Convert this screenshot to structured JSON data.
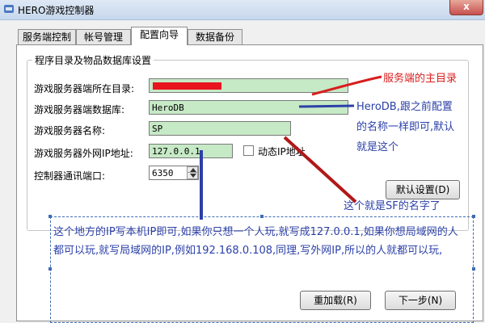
{
  "window": {
    "title": "HERO游戏控制器",
    "close_label": "x"
  },
  "tabs": [
    {
      "label": "服务端控制",
      "active": false
    },
    {
      "label": "帐号管理",
      "active": false
    },
    {
      "label": "配置向导",
      "active": true
    },
    {
      "label": "数据备份",
      "active": false
    }
  ],
  "group": {
    "title": "程序目录及物品数据库设置"
  },
  "form": {
    "server_dir_label": "游戏服务器端所在目录:",
    "server_dir_value": "",
    "db_label": "游戏服务器端数据库:",
    "db_value": "HeroDB",
    "name_label": "游戏服务器名称:",
    "name_value": "SP",
    "ip_label": "游戏服务器外网IP地址:",
    "ip_value": "127.0.0.1",
    "dynamic_ip_label": "动态IP地址",
    "dynamic_ip_checked": false,
    "port_label": "控制器通讯端口:",
    "port_value": "6350"
  },
  "buttons": {
    "default_settings": "默认设置(D)",
    "reload": "重加载(R)",
    "next": "下一步(N)"
  },
  "annotations": {
    "server_main_dir": "服务端的主目录",
    "herodb_note_line1": "HeroDB,跟之前配置",
    "herodb_note_line2": "的名称一样即可,默认",
    "herodb_note_line3": "就是这个",
    "sf_name_note": "这个就是SF的名字了",
    "ip_note": "这个地方的IP写本机IP即可,如果你只想一个人玩,就写成127.0.0.1,如果你想局域网的人都可以玩,就写局域网的IP,例如192.168.0.108,同理,写外网IP,所以的人就都可以玩,"
  },
  "colors": {
    "field_green": "#c6e9c6",
    "annotation_red": "#d81e1e",
    "annotation_blue": "#2c40a8",
    "redaction_red": "#e8141e"
  }
}
